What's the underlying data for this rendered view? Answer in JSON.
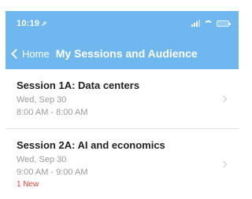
{
  "status_bar": {
    "time": "10:19",
    "location_glyph": "➚"
  },
  "nav": {
    "back_label": "Home",
    "title": "My Sessions and Audience"
  },
  "sessions": [
    {
      "title": "Session 1A: Data centers",
      "date": "Wed, Sep 30",
      "time": "8:00 AM - 8:00 AM",
      "badge": ""
    },
    {
      "title": "Session 2A: AI and economics",
      "date": "Wed, Sep 30",
      "time": "9:00 AM - 9:00 AM",
      "badge": "1 New"
    }
  ],
  "colors": {
    "header": "#6fb7ef",
    "badge": "#e8453c"
  }
}
